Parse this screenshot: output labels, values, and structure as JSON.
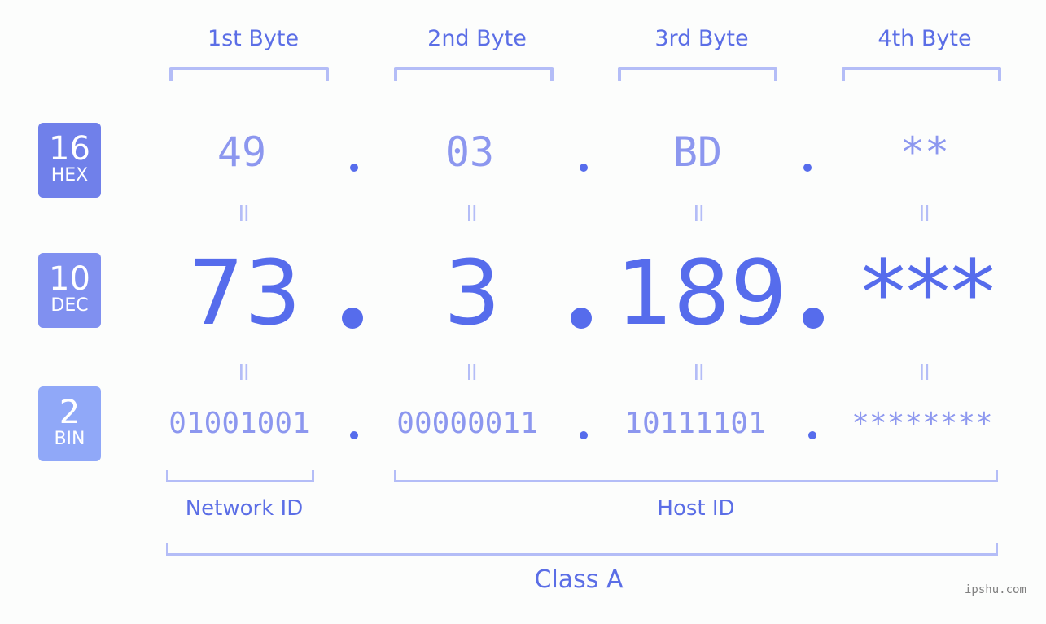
{
  "header": {
    "bytes": [
      "1st Byte",
      "2nd Byte",
      "3rd Byte",
      "4th Byte"
    ]
  },
  "rows": {
    "hex": {
      "base": "16",
      "name": "HEX",
      "color": "#7080ea",
      "values": [
        "49",
        "03",
        "BD",
        "**"
      ]
    },
    "dec": {
      "base": "10",
      "name": "DEC",
      "color": "#8090f0",
      "values": [
        "73",
        "3",
        "189",
        "***"
      ]
    },
    "bin": {
      "base": "2",
      "name": "BIN",
      "color": "#90a8f8",
      "values": [
        "01001001",
        "00000011",
        "10111101",
        "********"
      ]
    }
  },
  "separator": ".",
  "equals": "=",
  "groups": {
    "network_id": "Network ID",
    "host_id": "Host ID",
    "class": "Class A"
  },
  "watermark": "ipshu.com",
  "colors": {
    "accent": "#566cec",
    "light": "#8c97ef",
    "bracket": "#b4bdf7"
  }
}
